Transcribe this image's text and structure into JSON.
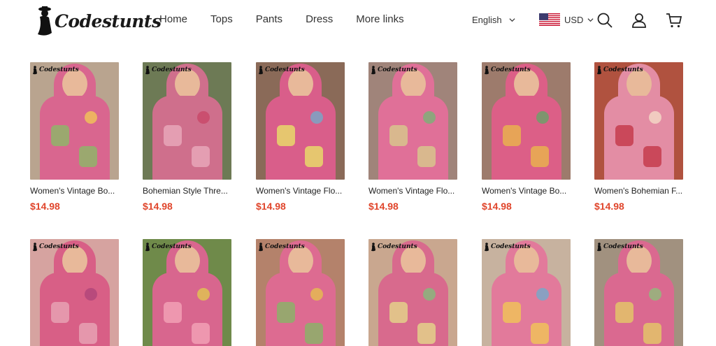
{
  "brand": {
    "name": "Codestunts"
  },
  "nav": [
    {
      "label": "Home"
    },
    {
      "label": "Tops"
    },
    {
      "label": "Pants"
    },
    {
      "label": "Dress"
    },
    {
      "label": "More links"
    }
  ],
  "header": {
    "language": "English",
    "currency": "USD"
  },
  "icons": {
    "search": "search-icon",
    "account": "user-icon",
    "cart": "cart-icon",
    "flag": "us-flag-icon"
  },
  "colors": {
    "price": "#e0452b",
    "text": "#222222"
  },
  "products": [
    {
      "title": "Women's Vintage Bo...",
      "price": "$14.98",
      "bg": "#b9a48f",
      "top": "#d9668f",
      "p1": "#8fb46a",
      "p2": "#f0c05a"
    },
    {
      "title": "Bohemian Style Thre...",
      "price": "$14.98",
      "bg": "#6d7a55",
      "top": "#cf6f8c",
      "p1": "#e8a7b8",
      "p2": "#c94a6a"
    },
    {
      "title": "Women's Vintage Flo...",
      "price": "$14.98",
      "bg": "#8a6a58",
      "top": "#d95e8a",
      "p1": "#e7d86a",
      "p2": "#7aa5c4"
    },
    {
      "title": "Women's Vintage Flo...",
      "price": "$14.98",
      "bg": "#a0847a",
      "top": "#e07098",
      "p1": "#d7c48c",
      "p2": "#7fae78"
    },
    {
      "title": "Women's Vintage Bo...",
      "price": "$14.98",
      "bg": "#9d7b6c",
      "top": "#dc5f87",
      "p1": "#e9b04f",
      "p2": "#6f9f6a"
    },
    {
      "title": "Women's Bohemian F...",
      "price": "$14.98",
      "bg": "#b0523f",
      "top": "#e38da4",
      "p1": "#c53c4e",
      "p2": "#f3d6c6"
    },
    {
      "title": "",
      "price": "",
      "bg": "#d6a3a0",
      "top": "#d85f86",
      "p1": "#e8a1b3",
      "p2": "#b3477a"
    },
    {
      "title": "",
      "price": "",
      "bg": "#6f8a4a",
      "top": "#d8668e",
      "p1": "#f2a0b5",
      "p2": "#e0c153"
    },
    {
      "title": "",
      "price": "",
      "bg": "#b4826b",
      "top": "#dd6b91",
      "p1": "#8cb069",
      "p2": "#e5b852"
    },
    {
      "title": "",
      "price": "",
      "bg": "#c9a78f",
      "top": "#d86a8d",
      "p1": "#e4d08a",
      "p2": "#8ab57d"
    },
    {
      "title": "",
      "price": "",
      "bg": "#c7b29f",
      "top": "#e27a9b",
      "p1": "#f0c15b",
      "p2": "#7aa7c8"
    },
    {
      "title": "",
      "price": "",
      "bg": "#a1917f",
      "top": "#da6990",
      "p1": "#e3c46a",
      "p2": "#93b97d"
    }
  ]
}
